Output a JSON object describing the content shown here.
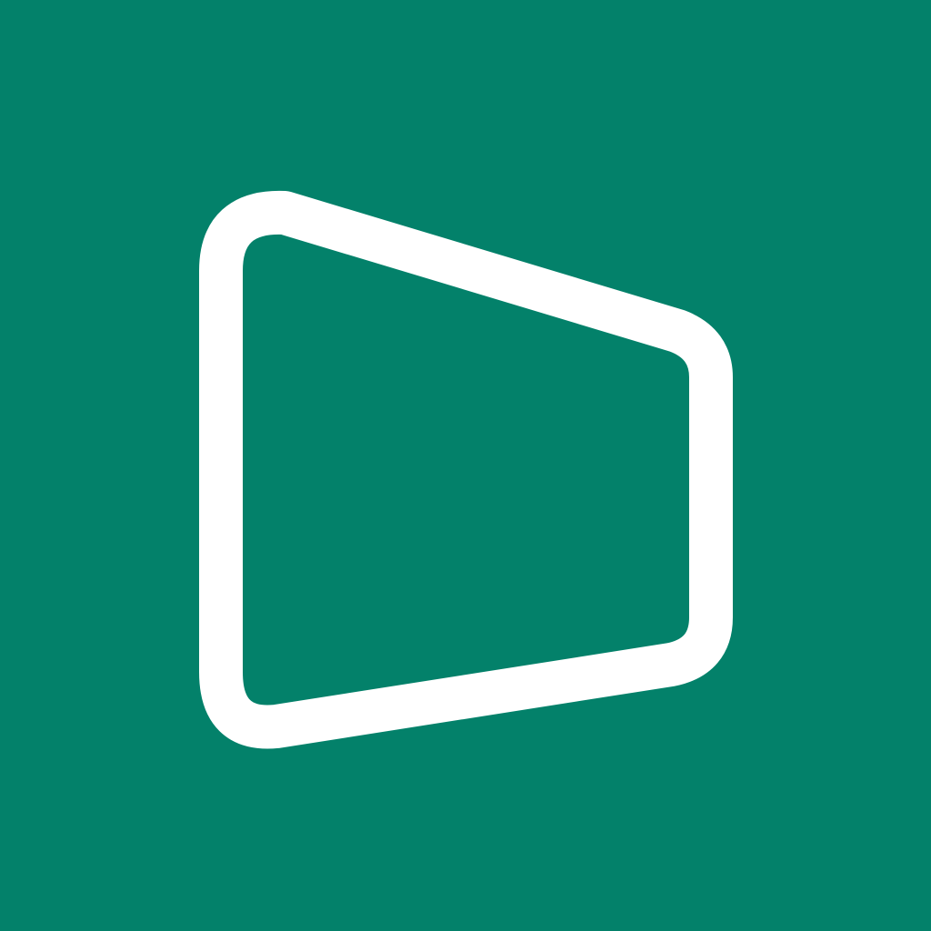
{
  "icon": {
    "name": "trapezoid-outline-logo",
    "background_color": "#03816A",
    "glyph_color": "#FFFFFF"
  }
}
